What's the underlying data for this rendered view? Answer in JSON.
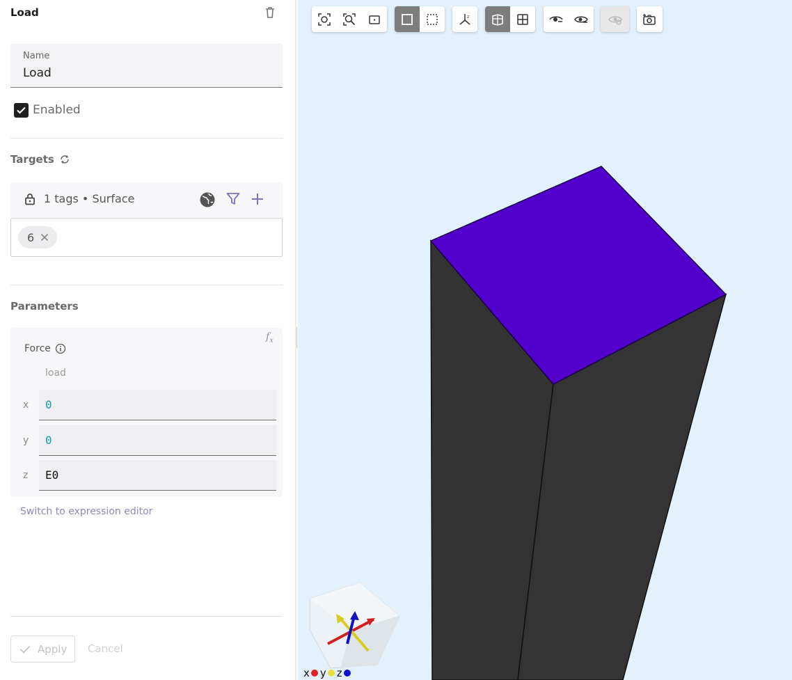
{
  "panel": {
    "title": "Load",
    "name_label": "Name",
    "name_value": "Load",
    "enabled_label": "Enabled",
    "enabled": true,
    "targets_heading": "Targets",
    "targets_summary": "1 tags • Surface",
    "tags": [
      "6"
    ],
    "parameters_heading": "Parameters",
    "force_label": "Force",
    "force_sub": "load",
    "components": [
      {
        "axis": "x",
        "value": "0",
        "kind": "number"
      },
      {
        "axis": "y",
        "value": "0",
        "kind": "number"
      },
      {
        "axis": "z",
        "value": "E0",
        "kind": "text"
      }
    ],
    "switch_link": "Switch to expression editor",
    "apply_label": "Apply",
    "cancel_label": "Cancel"
  },
  "viewport": {
    "toolbar_groups": [
      [
        "focus-selection-icon",
        "zoom-fit-icon",
        "zoom-area-icon"
      ],
      [
        "select-box-icon",
        "select-lasso-icon"
      ],
      [
        "axes-icon"
      ],
      [
        "solid-view-icon",
        "wireframe-view-icon"
      ],
      [
        "hide-icon",
        "show-icon"
      ],
      [
        "show-all-icon"
      ],
      [
        "screenshot-icon"
      ]
    ],
    "axis_legend": {
      "x": "x",
      "y": "y",
      "z": "z"
    },
    "colors": {
      "background": "#e3f1fc",
      "selected_face": "#5200cc",
      "body": "#333333",
      "axis_x": "#e02020",
      "axis_y": "#e8e040",
      "axis_z": "#1010d0"
    }
  }
}
